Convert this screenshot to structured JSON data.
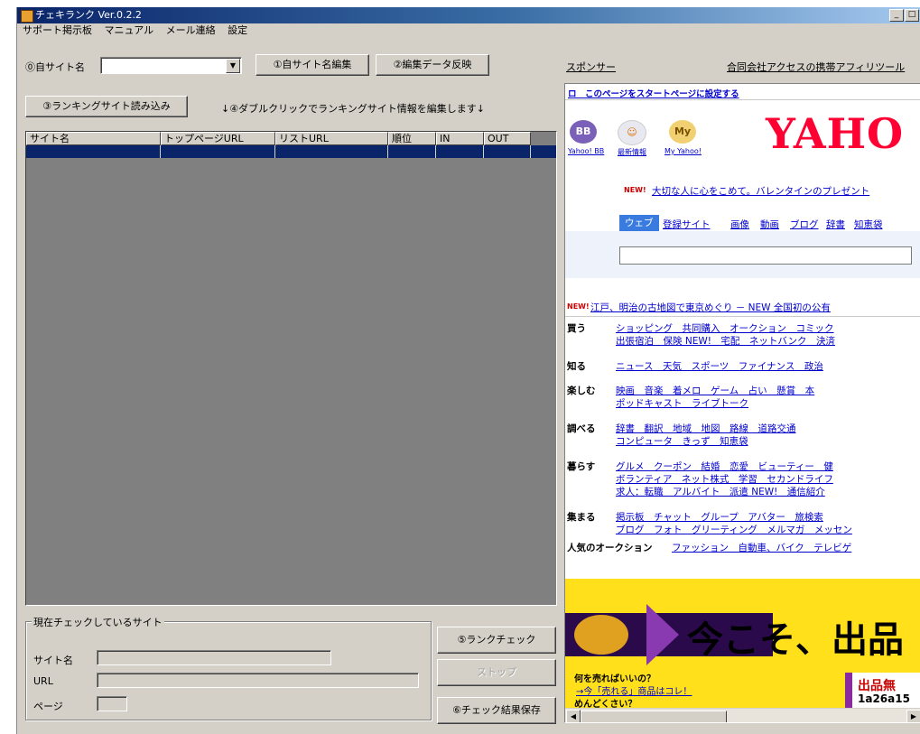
{
  "window": {
    "title": "チェキランク Ver.0.2.2",
    "buttons": [
      "_",
      "□"
    ]
  },
  "menu": [
    "サポート掲示板",
    "マニュアル",
    "メール連絡",
    "設定"
  ],
  "site": {
    "label": "⓪自サイト名",
    "value": "",
    "edit_btn": "①自サイト名編集",
    "reflect_btn": "②編集データ反映"
  },
  "ranking": {
    "load_btn": "③ランキングサイト読み込み",
    "hint": "↓④ダブルクリックでランキングサイト情報を編集します↓"
  },
  "table": {
    "columns": [
      "サイト名",
      "トップページURL",
      "リストURL",
      "順位",
      "IN",
      "OUT"
    ]
  },
  "check": {
    "group_title": "現在チェックしているサイト",
    "site_label": "サイト名",
    "url_label": "URL",
    "page_label": "ページ",
    "rank_btn": "⑤ランクチェック",
    "stop_btn": "ストップ",
    "save_btn": "⑥チェック結果保存"
  },
  "sponsor": {
    "label": "スポンサー",
    "link": "合同会社アクセスの携帯アフィリツール"
  },
  "browser": {
    "start_page": "ロ　このページをスタートページに設定する",
    "logo": "YAHO",
    "icons": [
      {
        "icon": "bb-icon",
        "text": "BB",
        "label": "Yahoo! BB"
      },
      {
        "icon": "news-icon",
        "text": "☺",
        "label": "最新情報"
      },
      {
        "icon": "my-icon",
        "text": "My",
        "label": "My Yahoo!"
      }
    ],
    "promo": "大切な人に心をこめて。バレンタインのプレゼント",
    "search_tabs": [
      "ウェブ",
      "登録サイト",
      "画像",
      "動画",
      "ブログ",
      "辞書",
      "知恵袋"
    ],
    "news": "江戸、明治の古地図で東京めぐり － NEW 全国初の公有",
    "new_tag": "NEW!",
    "dir": [
      {
        "cat": "買う",
        "lines": [
          "ショッピング　共同購入　オークション　コミック",
          "出張宿泊　保険 NEW!　宅配　ネットバンク　決済"
        ]
      },
      {
        "cat": "知る",
        "lines": [
          "ニュース　天気　スポーツ　ファイナンス　政治"
        ]
      },
      {
        "cat": "楽しむ",
        "lines": [
          "映画　音楽　着メロ　ゲーム　占い　懸賞　本",
          "ポッドキャスト　ライブトーク"
        ]
      },
      {
        "cat": "調べる",
        "lines": [
          "辞書　翻訳　地域　地図　路線　道路交通",
          "コンピュータ　きっず　知恵袋"
        ]
      },
      {
        "cat": "暮らす",
        "lines": [
          "グルメ　クーポン　結婚　恋愛　ビューティー　健",
          "ボランティア　ネット株式　学習　セカンドライフ",
          "求人：転職　アルバイト　派遣 NEW!　通信紹介"
        ]
      },
      {
        "cat": "集まる",
        "lines": [
          "掲示板　チャット　グループ　アバター　旅検索",
          "ブログ　フォト　グリーティング　メルマガ　メッセン"
        ]
      }
    ],
    "auction": {
      "label": "人気のオークション",
      "links": "ファッション　自動車、バイク　テレビゲ"
    },
    "banner": {
      "main": "今こそ、出品",
      "q1": "何を売ればいいの？",
      "q1_link": "→今「売れる」商品はコレ！",
      "q2": "めんどくさい？",
      "side": "出品無",
      "date": "1a26a15"
    }
  },
  "colors": {
    "face": "#d4d0c8",
    "list_bg": "#808080",
    "selection": "#0a246a",
    "yahoo_red": "#ff0033"
  }
}
